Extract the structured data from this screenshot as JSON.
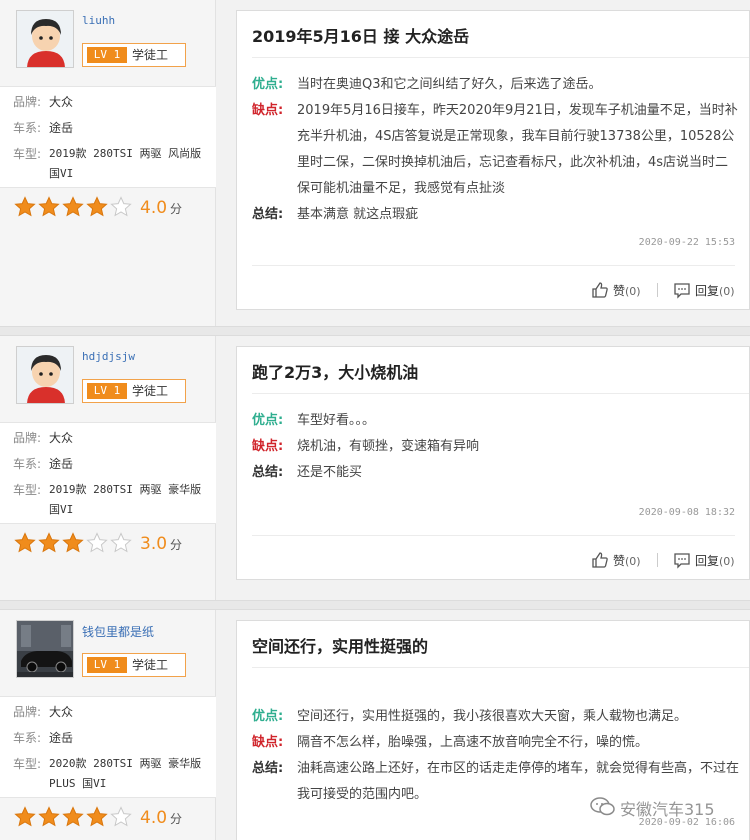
{
  "reviews": [
    {
      "username": "liuhh",
      "level": "LV 1",
      "rank": "学徒工",
      "brand_key": "品牌:",
      "brand": "大众",
      "series_key": "车系:",
      "series": "途岳",
      "model_key": "车型:",
      "model_line1": "2019款 280TSI 两驱 风尚版",
      "model_line2": "国VI",
      "stars": 4,
      "score": "4.0",
      "score_unit": "分",
      "title": "2019年5月16日 接 大众途岳",
      "pros_label": "优点:",
      "pros": "当时在奥迪Q3和它之间纠结了好久，后来选了途岳。",
      "cons_label": "缺点:",
      "cons": "2019年5月16日接车，昨天2020年9月21日，发现车子机油量不足，当时补充半升机油，4S店答复说是正常现象，我车目前行驶13738公里，10528公里时二保，二保时换掉机油后，忘记查看标尺，此次补机油，4s店说当时二保可能机油量不足，我感觉有点扯淡",
      "summary_label": "总结:",
      "summary": "基本满意 就这点瑕疵",
      "date": "2020-09-22 15:53",
      "like_label": "赞",
      "like_count": "(0)",
      "reply_label": "回复",
      "reply_count": "(0)"
    },
    {
      "username": "hdjdjsjw",
      "level": "LV 1",
      "rank": "学徒工",
      "brand_key": "品牌:",
      "brand": "大众",
      "series_key": "车系:",
      "series": "途岳",
      "model_key": "车型:",
      "model_line1": "2019款 280TSI 两驱 豪华版",
      "model_line2": "国VI",
      "stars": 3,
      "score": "3.0",
      "score_unit": "分",
      "title": "跑了2万3，大小烧机油",
      "pros_label": "优点:",
      "pros": "车型好看。。。",
      "cons_label": "缺点:",
      "cons": "烧机油，有顿挫，变速箱有异响",
      "summary_label": "总结:",
      "summary": "还是不能买",
      "date": "2020-09-08 18:32",
      "like_label": "赞",
      "like_count": "(0)",
      "reply_label": "回复",
      "reply_count": "(0)"
    },
    {
      "username": "钱包里都是纸",
      "level": "LV 1",
      "rank": "学徒工",
      "brand_key": "品牌:",
      "brand": "大众",
      "series_key": "车系:",
      "series": "途岳",
      "model_key": "车型:",
      "model_line1": "2020款 280TSI 两驱 豪华版",
      "model_line2": "PLUS 国VI",
      "stars": 4,
      "score": "4.0",
      "score_unit": "分",
      "title": "空间还行，实用性挺强的",
      "pros_label": "优点:",
      "pros": "空间还行，实用性挺强的，我小孩很喜欢大天窗，乘人载物也满足。",
      "cons_label": "缺点:",
      "cons": "隔音不怎么样，胎噪强，上高速不放音响完全不行，噪的慌。",
      "summary_label": "总结:",
      "summary": "油耗高速公路上还好，在市区的话走走停停的堵车，就会觉得有些高，不过在我可接受的范围内吧。",
      "date": "2020-09-02 16:06"
    }
  ],
  "watermark": "安徽汽车315",
  "colors": {
    "accent": "#f08c1c",
    "pros": "#2fae8f",
    "cons": "#d0242b",
    "username": "#3a6fb5"
  },
  "icons": {
    "like": "thumbs-up-icon",
    "reply": "comment-icon",
    "star": "star-icon",
    "watermark": "wechat-icon"
  }
}
